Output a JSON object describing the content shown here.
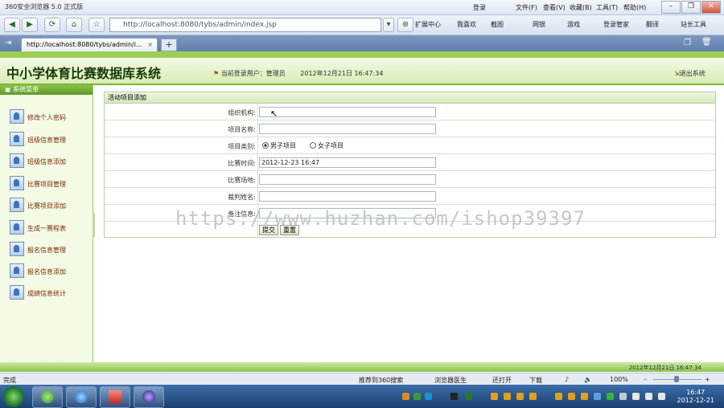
{
  "browser": {
    "title": "360安全浏览器 5.0 正式版",
    "menu": [
      {
        "label": "登录"
      },
      {
        "label": "文件(F)"
      },
      {
        "label": "查看(V)"
      },
      {
        "label": "收藏(B)"
      },
      {
        "label": "工具(T)"
      },
      {
        "label": "帮助(H)"
      }
    ],
    "address": "http://localhost:8080/tybs/admin/index.jsp",
    "toolbar": [
      {
        "label": "扩展中心"
      },
      {
        "label": "我喜欢"
      },
      {
        "label": "截图"
      },
      {
        "label": "网银"
      },
      {
        "label": "游戏"
      },
      {
        "label": "登录管家"
      },
      {
        "label": "翻译"
      },
      {
        "label": "站长工具"
      }
    ],
    "tab": "http://localhost:8080/tybs/admin/i...",
    "tab_close": "×",
    "new_tab": "+"
  },
  "app": {
    "system_title": "中小学体育比赛数据库系统",
    "current_user_label": "当前登录用户：管理员",
    "current_time": "2012年12月21日  16:47:34",
    "logout": "退出系统",
    "sidebar_header": "系统菜单",
    "sidebar_items": [
      {
        "label": "修改个人密码"
      },
      {
        "label": "班级信息管理"
      },
      {
        "label": "班级信息添加"
      },
      {
        "label": "比赛项目管理"
      },
      {
        "label": "比赛项目添加"
      },
      {
        "label": "生成一赛程表"
      },
      {
        "label": "报名信息管理"
      },
      {
        "label": "报名信息添加"
      },
      {
        "label": "成绩信息统计"
      }
    ],
    "form": {
      "title": "活动项目添加",
      "fields": [
        {
          "label": "组织机构:",
          "value": ""
        },
        {
          "label": "项目名称:",
          "value": ""
        },
        {
          "label": "项目类别:",
          "options": [
            "男子项目",
            "女子项目"
          ],
          "selected": "男子项目"
        },
        {
          "label": "比赛时间:",
          "value": "2012-12-23 16:47"
        },
        {
          "label": "比赛场地:",
          "value": ""
        },
        {
          "label": "裁判姓名:",
          "value": ""
        },
        {
          "label": "备注信息:",
          "value": ""
        }
      ],
      "submit": "提交",
      "reset": "重置"
    },
    "footer_datetime": "2012年12月21日  16:47:34",
    "watermark": "https://www.huzhan.com/ishop39397"
  },
  "statusbar": {
    "left": "完成",
    "items": [
      {
        "label": "推荐到360搜索"
      },
      {
        "label": "浏览器医生"
      },
      {
        "label": "还打开"
      },
      {
        "label": "下载"
      }
    ],
    "zoom": "100%"
  },
  "taskbar": {
    "clock_time": "16:47",
    "clock_date": "2012-12-21"
  },
  "colors": {
    "accent_green": "#7cb638",
    "sidebar_text": "#7a2c00",
    "taskbar": "#1c3f70"
  }
}
